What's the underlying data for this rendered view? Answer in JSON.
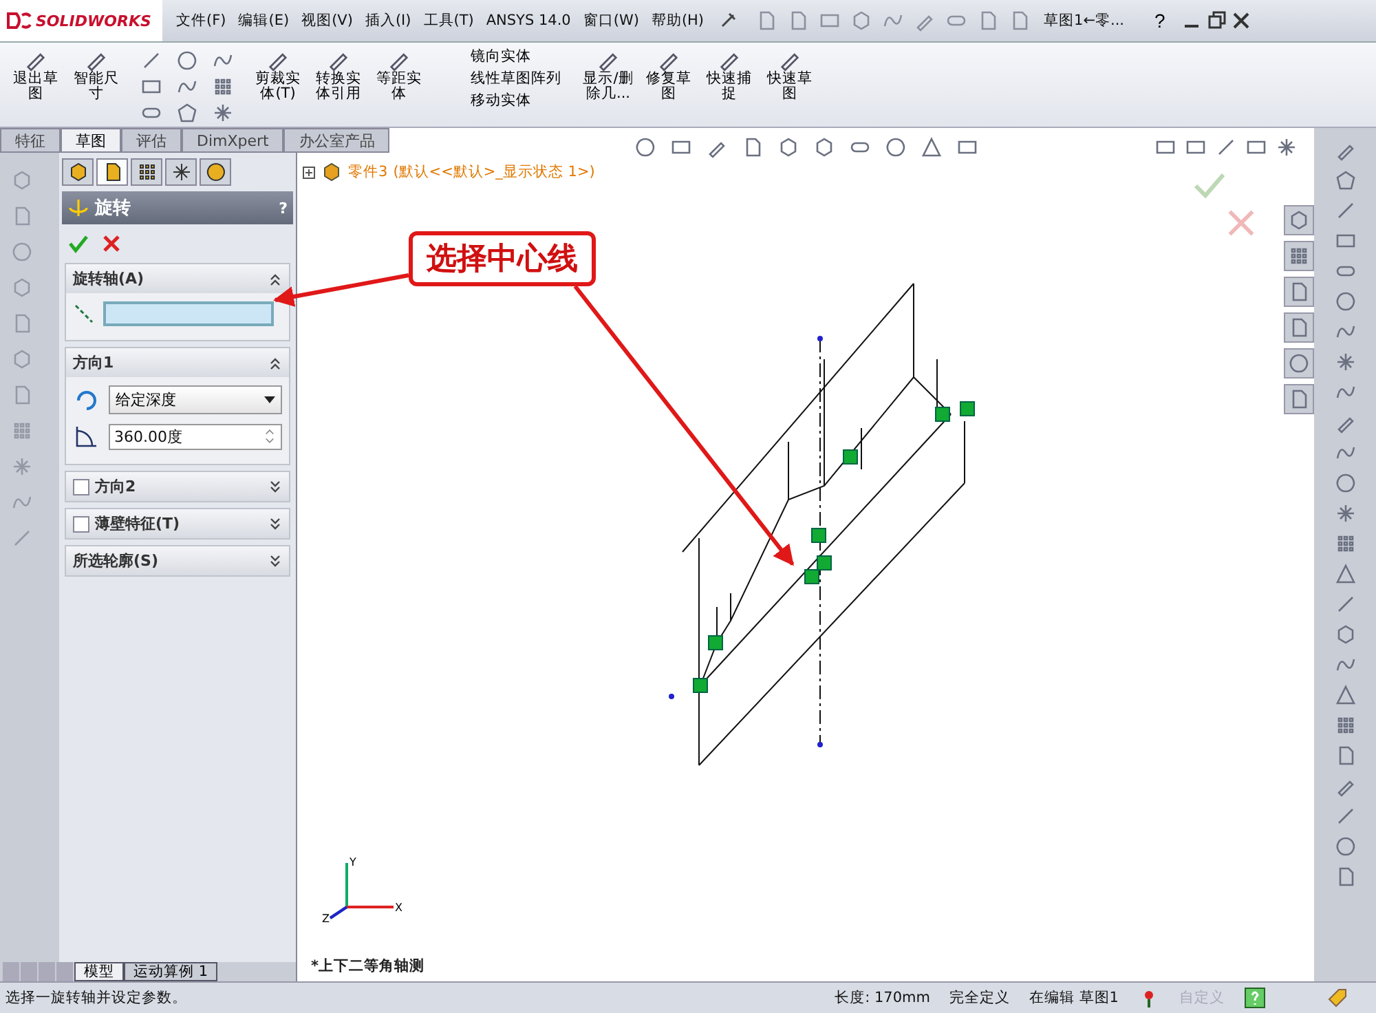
{
  "title_bar": {
    "logo": "SOLIDWORKS",
    "menus": [
      "文件(F)",
      "编辑(E)",
      "视图(V)",
      "插入(I)",
      "工具(T)",
      "ANSYS 14.0",
      "窗口(W)",
      "帮助(H)"
    ],
    "document_title": "草图1←零...",
    "help": "?"
  },
  "ribbon": {
    "tools": [
      {
        "kind": "big",
        "label": "退出草图"
      },
      {
        "kind": "big",
        "label": "智能尺寸"
      },
      {
        "kind": "grid"
      },
      {
        "kind": "big",
        "label": "剪裁实体(T)"
      },
      {
        "kind": "big",
        "label": "转换实体引用"
      },
      {
        "kind": "big",
        "label": "等距实体"
      },
      {
        "kind": "list",
        "items": [
          "镜向实体",
          "线性草图阵列",
          "移动实体"
        ]
      },
      {
        "kind": "big",
        "label": "显示/删除几..."
      },
      {
        "kind": "big",
        "label": "修复草图"
      },
      {
        "kind": "big",
        "label": "快速捕捉"
      },
      {
        "kind": "big",
        "label": "快速草图"
      }
    ]
  },
  "command_tabs": [
    {
      "label": "特征",
      "selected": false
    },
    {
      "label": "草图",
      "selected": true
    },
    {
      "label": "评估",
      "selected": false
    },
    {
      "label": "DimXpert",
      "selected": false
    },
    {
      "label": "办公室产品",
      "selected": false
    }
  ],
  "property_manager": {
    "tabs": [
      {
        "selected": false
      },
      {
        "selected": true
      },
      {
        "selected": false
      },
      {
        "selected": false
      },
      {
        "selected": false
      }
    ],
    "title": "旋转",
    "help": "?",
    "sections": [
      {
        "kind": "axis",
        "title": "旋转轴(A)",
        "expanded": true
      },
      {
        "kind": "direction",
        "title": "方向1",
        "expanded": true,
        "end_condition": "给定深度",
        "angle": "360.00度"
      },
      {
        "kind": "checkbox",
        "title": "方向2",
        "checked": false,
        "expanded": false
      },
      {
        "kind": "checkbox",
        "title": "薄壁特征(T)",
        "checked": false,
        "expanded": false
      },
      {
        "kind": "plain",
        "title": "所选轮廓(S)",
        "expanded": false
      }
    ]
  },
  "graphics": {
    "tree_node": {
      "name": "零件3",
      "config": "(默认<<默认>_显示状态 1>)"
    },
    "callout": "选择中心线",
    "view_name": "*上下二等角轴测",
    "triad_labels": [
      "Y",
      "X",
      "Z"
    ]
  },
  "bottom_tabs": [
    {
      "label": "模型",
      "selected": true
    },
    {
      "label": "运动算例 1",
      "selected": false
    }
  ],
  "status_bar": {
    "message": "选择一旋转轴并设定参数。",
    "length": "长度: 170mm",
    "state": "完全定义",
    "editing": "在编辑 草图1",
    "units": "自定义",
    "units_disabled": true
  }
}
